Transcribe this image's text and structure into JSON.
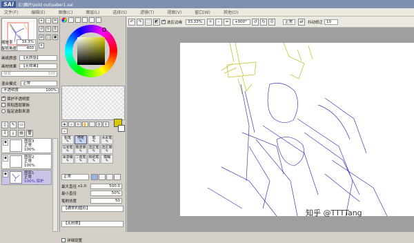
{
  "app": {
    "logo": "SAI",
    "title": "E:\\图片\\sold out\\saber1.sai"
  },
  "menu": [
    "文件(F)",
    "编辑(E)",
    "图像(C)",
    "图层(L)",
    "选择(S)",
    "滤镜(T)",
    "视图(V)",
    "窗口(W)",
    "其他(O)"
  ],
  "nav": {
    "zoom_label": "缩放率",
    "zoom_value": "33.3%",
    "rotate_label": "旋转角度",
    "rotate_value": "400"
  },
  "paper_texture": {
    "label": "画纸质感",
    "value": "【无质感】"
  },
  "paper_effect": {
    "label": "画材效果",
    "value": "【无效果】"
  },
  "effect_sub": {
    "label": "强度",
    "value": "100"
  },
  "blend": {
    "label": "混合模式",
    "value": "正常"
  },
  "opacity": {
    "label": "不透明度",
    "value": "100%"
  },
  "checks": {
    "protect": "保护不透明度",
    "clip": "剪贴图层蒙板",
    "select_source": "指定选取来源"
  },
  "layers": [
    {
      "name": "图层3",
      "mode": "正常",
      "opacity": "100%"
    },
    {
      "name": "图层2",
      "mode": "正常",
      "opacity": "100%"
    },
    {
      "name": "图层1",
      "mode": "正常",
      "opacity": "100% 保护"
    }
  ],
  "colors": {
    "fg": "#d6c700",
    "bg": "#ffffff",
    "wheel_accent": "#d8d000",
    "paper": "#ffffff",
    "sketch_yellow": "#c8c230",
    "sketch_blue": "#3a3ab8"
  },
  "tools": [
    [
      "铅笔",
      "喷枪",
      "笔",
      "水彩笔"
    ],
    [
      "马克笔",
      "橡皮擦",
      "选区笔",
      "选区擦"
    ],
    [
      "油漆桶",
      "二值笔",
      "和纸笔",
      "模糊"
    ]
  ],
  "brush": {
    "mode": "正常",
    "max_size_label": "最大直径",
    "max_size_mult": "x1.0",
    "max_size_value": "500.0",
    "min_size_label": "最小直径",
    "min_size_value": "50%",
    "density_label": "笔刷浓度",
    "density_value": "50",
    "shape_value": "【通常的圆形】",
    "texture_value": "【无材质】",
    "detail_label": "详细设置"
  },
  "toolbar": {
    "select_edge": "选区边缘",
    "zoom": "33.33%",
    "angle": "+000°",
    "mode": "正常",
    "stabilizer_label": "抖动修正",
    "stabilizer_value": "10"
  },
  "watermark": "知乎 @TTTTang"
}
